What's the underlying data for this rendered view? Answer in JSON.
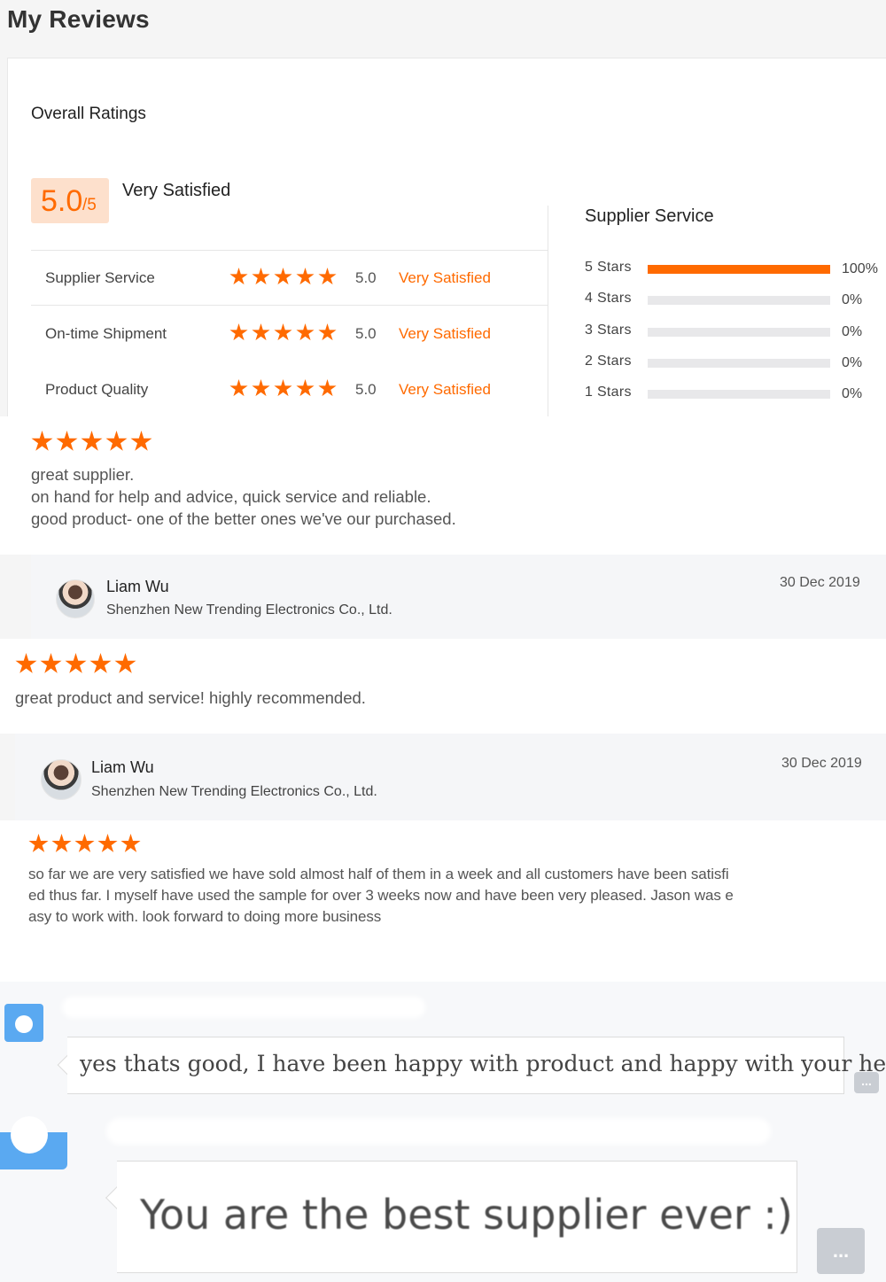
{
  "page": {
    "title": "My Reviews"
  },
  "overall": {
    "heading": "Overall Ratings",
    "score": "5.0",
    "max": "/5",
    "label": "Very Satisfied"
  },
  "dimensions": [
    {
      "name": "Supplier Service",
      "stars": 5,
      "score": "5.0",
      "label": "Very Satisfied"
    },
    {
      "name": "On-time Shipment",
      "stars": 5,
      "score": "5.0",
      "label": "Very Satisfied"
    },
    {
      "name": "Product Quality",
      "stars": 5,
      "score": "5.0",
      "label": "Very Satisfied"
    }
  ],
  "distribution": {
    "title": "Supplier Service",
    "rows": [
      {
        "label": "5  Stars",
        "percent": 100,
        "percent_text": "100%"
      },
      {
        "label": "4  Stars",
        "percent": 0,
        "percent_text": "0%"
      },
      {
        "label": "3  Stars",
        "percent": 0,
        "percent_text": "0%"
      },
      {
        "label": "2  Stars",
        "percent": 0,
        "percent_text": "0%"
      },
      {
        "label": "1  Stars",
        "percent": 0,
        "percent_text": "0%"
      }
    ]
  },
  "reviews": [
    {
      "stars": 5,
      "lines": [
        "great supplier.",
        "on hand for help and advice, quick service and reliable.",
        "good product- one of the better ones we've our purchased."
      ],
      "reviewer": {
        "name": "Liam Wu",
        "company": "Shenzhen New Trending Electronics Co., Ltd.",
        "date": "30 Dec 2019"
      }
    },
    {
      "stars": 5,
      "lines": [
        "great product and service! highly recommended."
      ],
      "reviewer": {
        "name": "Liam Wu",
        "company": "Shenzhen New Trending Electronics Co., Ltd.",
        "date": "30 Dec 2019"
      }
    },
    {
      "stars": 5,
      "lines": [
        "so far we are very satisfied we have sold almost half of them in a week and all customers have been satisfi",
        "ed thus far. I myself have used the sample for over 3 weeks now and have been very pleased. Jason was e",
        "asy to work with. look forward to doing more business"
      ]
    }
  ],
  "chat": {
    "messages": [
      {
        "text": "yes thats good, I have been happy with product and happy with your help!"
      },
      {
        "text": "You are the best supplier ever :)"
      }
    ],
    "more_label": "..."
  },
  "colors": {
    "accent": "#ff6a00",
    "score_bg": "#fde0cc",
    "chat_avatar": "#5aa9f1"
  },
  "icons": {
    "star": "star-icon",
    "more": "more-icon"
  }
}
